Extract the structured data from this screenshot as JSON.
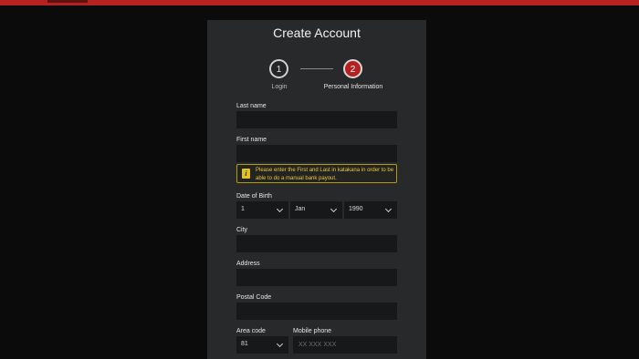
{
  "form": {
    "title": "Create Account",
    "steps": [
      {
        "number": "1",
        "label": "Login"
      },
      {
        "number": "2",
        "label": "Personal Information"
      }
    ],
    "last_name_label": "Last name",
    "first_name_label": "First name",
    "notice": "Please enter the First and Last in katakana in order to be able to do a manual bank payout.",
    "notice_icon_glyph": "i",
    "dob_label": "Date of Birth",
    "dob_day": "1",
    "dob_month": "Jan",
    "dob_year": "1990",
    "city_label": "City",
    "address_label": "Address",
    "postal_label": "Postal Code",
    "area_code_label": "Area code",
    "area_code_value": "81",
    "mobile_label": "Mobile phone",
    "mobile_placeholder": "XX XXX XXX"
  },
  "colors": {
    "accent": "#b52020",
    "panel": "#27292b",
    "notice_border": "#b39a12"
  }
}
